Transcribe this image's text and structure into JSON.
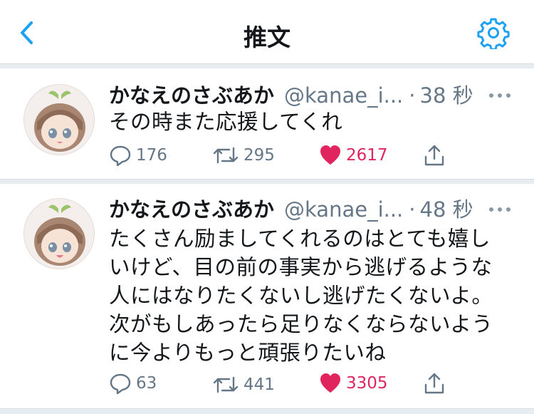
{
  "colors": {
    "accent": "#1da1f2",
    "like": "#e0245e",
    "muted": "#657786",
    "text": "#14171a"
  },
  "header": {
    "title": "推文",
    "back_icon": "chevron-left-icon",
    "settings_icon": "gear-icon"
  },
  "tweets": [
    {
      "name": "かなえのさぶあか",
      "handle": "@kanae_i...",
      "dot": "·",
      "time": "38 秒",
      "text": "その時また応援してくれ",
      "replies": "176",
      "retweets": "295",
      "likes": "2617"
    },
    {
      "name": "かなえのさぶあか",
      "handle": "@kanae_i...",
      "dot": "·",
      "time": "48 秒",
      "text": "たくさん励ましてくれるのはとても嬉し\nいけど、目の前の事実から逃げるような\n人にはなりたくないし逃げたくないよ。\n次がもしあったら足りなくならないよう\nに今よりもっと頑張りたいね",
      "replies": "63",
      "retweets": "441",
      "likes": "3305"
    }
  ]
}
